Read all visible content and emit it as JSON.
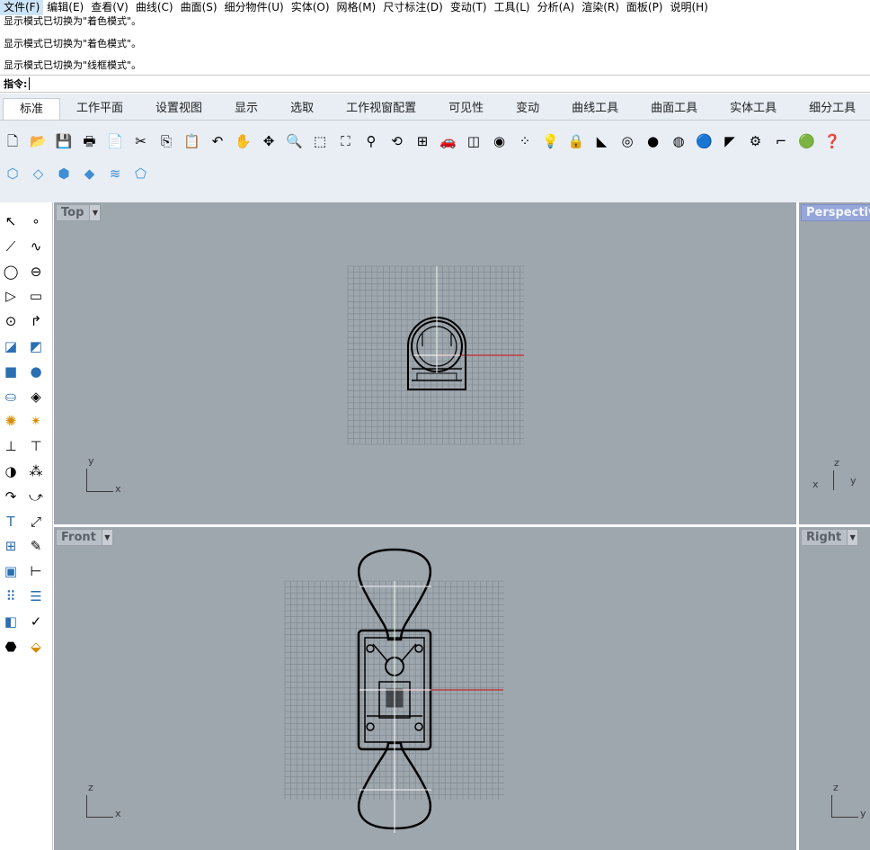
{
  "menu": [
    "文件(F)",
    "编辑(E)",
    "查看(V)",
    "曲线(C)",
    "曲面(S)",
    "细分物件(U)",
    "实体(O)",
    "网格(M)",
    "尺寸标注(D)",
    "变动(T)",
    "工具(L)",
    "分析(A)",
    "渲染(R)",
    "面板(P)",
    "说明(H)"
  ],
  "history": [
    "显示模式已切换为\"着色模式\"。",
    "显示模式已切换为\"着色模式\"。",
    "显示模式已切换为\"线框模式\"。"
  ],
  "command": {
    "prompt": "指令:"
  },
  "tabs": [
    "标准",
    "工作平面",
    "设置视图",
    "显示",
    "选取",
    "工作视窗配置",
    "可见性",
    "变动",
    "曲线工具",
    "曲面工具",
    "实体工具",
    "细分工具"
  ],
  "toolbar_icons": [
    "new-icon",
    "open-icon",
    "save-icon",
    "print-icon",
    "import-icon",
    "cut-icon",
    "copy-icon",
    "paste-icon",
    "undo-icon",
    "pan-icon",
    "rotate-view-icon",
    "zoom-icon",
    "zoom-window-icon",
    "zoom-extents-icon",
    "zoom-selected-icon",
    "undo-view-icon",
    "four-viewports-icon",
    "car-icon",
    "ground-plane-icon",
    "circle-dot-icon",
    "select-points-icon",
    "light-icon",
    "lock-icon",
    "material-icon",
    "color-wheel-icon",
    "shaded-sphere-icon",
    "ghosted-sphere-icon",
    "rendered-sphere-icon",
    "render-tools-icon",
    "options-gear-icon",
    "dimension-icon",
    "grasshopper-icon",
    "help-icon"
  ],
  "toolbar2_icons": [
    "subd-cube-icon",
    "subd-octa-icon",
    "subd-sphere-icon",
    "subd-diamond-icon",
    "subd-wave-icon",
    "subd-cage-icon"
  ],
  "viewports": {
    "top": {
      "label": "Top",
      "axis": [
        "y",
        "x"
      ]
    },
    "perspective": {
      "label": "Perspective",
      "axis": [
        "z",
        "x",
        "y"
      ]
    },
    "front": {
      "label": "Front",
      "axis": [
        "z",
        "x"
      ]
    },
    "right": {
      "label": "Right",
      "axis": [
        "z",
        "y"
      ]
    }
  },
  "colors": {
    "viewport_bg": "#9ea6ae",
    "grid_line": "#7d858c",
    "x_axis": "#c62828",
    "y_axis": "#2e9b3a",
    "active_label": "#95a6d8"
  }
}
